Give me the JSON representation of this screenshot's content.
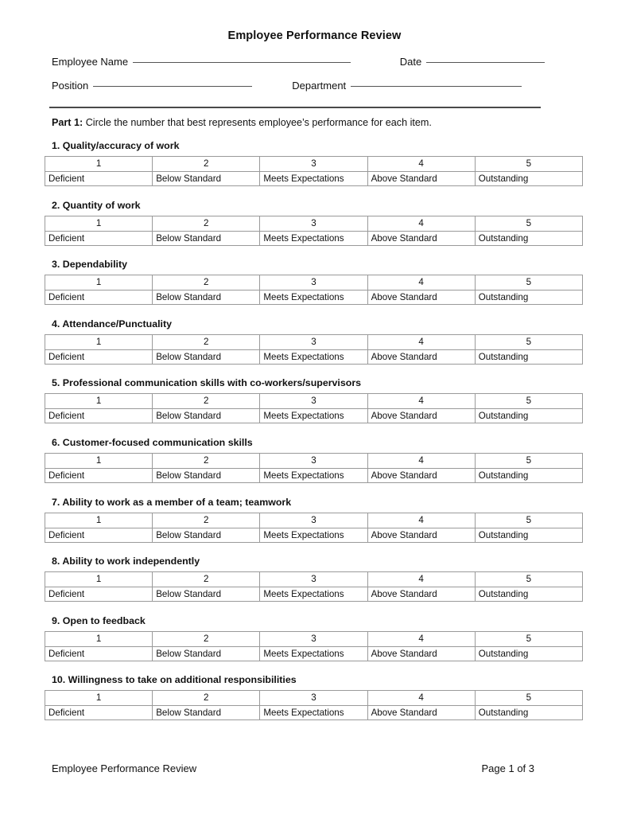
{
  "document": {
    "title": "Employee Performance Review"
  },
  "identity": {
    "employee_name_label": "Employee Name",
    "date_label": "Date",
    "position_label": "Position",
    "department_label": "Department",
    "employee_name_value": "",
    "date_value": "",
    "position_value": "",
    "department_value": ""
  },
  "part1": {
    "label": "Part 1:",
    "instruction": "Circle the number that best represents employee’s performance for each item."
  },
  "scale": {
    "scores": [
      "1",
      "2",
      "3",
      "4",
      "5"
    ],
    "labels": [
      "Deficient",
      "Below Standard",
      "Meets Expectations",
      "Above Standard",
      "Outstanding"
    ]
  },
  "items": [
    {
      "heading": "1. Quality/accuracy of work"
    },
    {
      "heading": "2. Quantity of work"
    },
    {
      "heading": "3. Dependability"
    },
    {
      "heading": "4. Attendance/Punctuality"
    },
    {
      "heading": "5. Professional communication skills with co-workers/supervisors"
    },
    {
      "heading": "6. Customer-focused communication skills"
    },
    {
      "heading": "7. Ability to work as a member of a team; teamwork"
    },
    {
      "heading": "8. Ability to work independently"
    },
    {
      "heading": "9. Open to feedback"
    },
    {
      "heading": "10. Willingness to take on additional responsibilities"
    }
  ],
  "footer": {
    "left": "Employee Performance Review",
    "right": "Page 1 of 3"
  },
  "colors": {
    "text": "#111111",
    "table_border": "#9a9a9a",
    "table_outer_border": "#7d7d7d",
    "divider": "#4a4a4a",
    "field_rule": "#555555",
    "page_background": "#ffffff"
  }
}
